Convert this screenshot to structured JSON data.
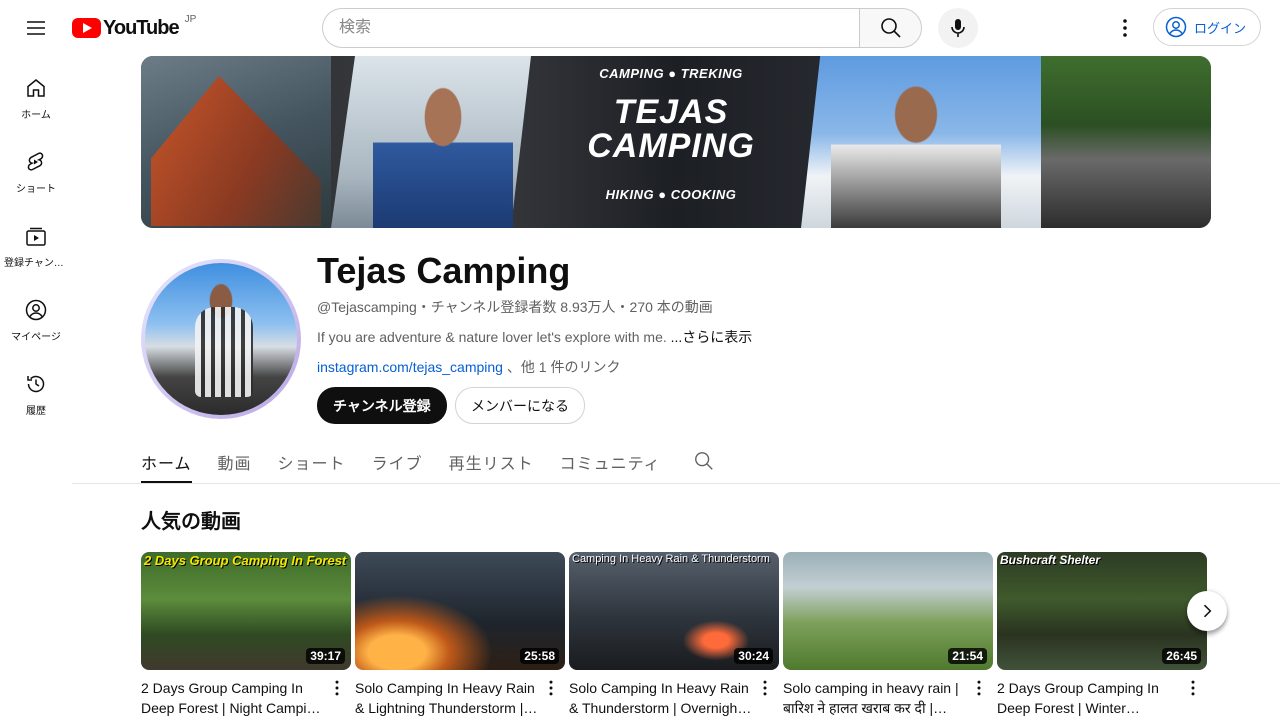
{
  "masthead": {
    "logo_text": "YouTube",
    "country": "JP",
    "search_placeholder": "検索",
    "login_label": "ログイン"
  },
  "guide": {
    "items": [
      {
        "label": "ホーム",
        "icon": "home-icon"
      },
      {
        "label": "ショート",
        "icon": "shorts-icon"
      },
      {
        "label": "登録チャンネル",
        "icon": "subscriptions-icon"
      },
      {
        "label": "マイページ",
        "icon": "you-icon"
      },
      {
        "label": "履歴",
        "icon": "history-icon"
      }
    ]
  },
  "banner": {
    "top_text": "CAMPING ● TREKING",
    "title_line1": "TEJAS",
    "title_line2": "CAMPING",
    "bottom_text": "HIKING ● COOKING"
  },
  "channel": {
    "name": "Tejas Camping",
    "meta": "@Tejascamping・チャンネル登録者数 8.93万人・270 本の動画",
    "description": "If you are adventure & nature lover let's explore with me.",
    "more_label": "...さらに表示",
    "link": "instagram.com/tejas_camping",
    "link_suffix": "、他 1 件のリンク",
    "subscribe_label": "チャンネル登録",
    "member_label": "メンバーになる"
  },
  "tabs": [
    {
      "label": "ホーム",
      "active": true
    },
    {
      "label": "動画",
      "active": false
    },
    {
      "label": "ショート",
      "active": false
    },
    {
      "label": "ライブ",
      "active": false
    },
    {
      "label": "再生リスト",
      "active": false
    },
    {
      "label": "コミュニティ",
      "active": false
    }
  ],
  "section": {
    "title": "人気の動画"
  },
  "videos": [
    {
      "caption": "2 Days Group Camping In Forest",
      "duration": "39:17",
      "title_line1": "2 Days Group Camping In",
      "title_line2": "Deep Forest | Night Campin…"
    },
    {
      "caption": "",
      "duration": "25:58",
      "title_line1": "Solo Camping In Heavy Rain",
      "title_line2": "& Lightning Thunderstorm |…"
    },
    {
      "caption": "Camping In Heavy Rain & Thunderstorm",
      "duration": "30:24",
      "title_line1": "Solo Camping In Heavy Rain",
      "title_line2": "& Thunderstorm | Overnight…"
    },
    {
      "caption": "",
      "duration": "21:54",
      "title_line1": "Solo camping in heavy rain |",
      "title_line2": "बारिश ने हालत खराब कर दी |…"
    },
    {
      "caption": "Bushcraft Shelter",
      "duration": "26:45",
      "title_line1": "2 Days Group Camping In",
      "title_line2": "Deep Forest | Winter…"
    }
  ]
}
